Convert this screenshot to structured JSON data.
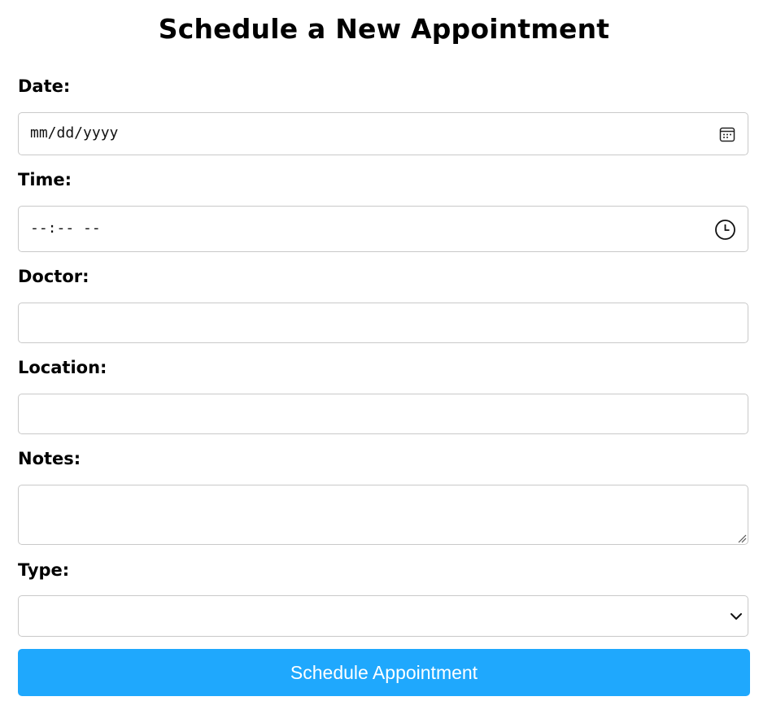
{
  "page": {
    "title": "Schedule a New Appointment"
  },
  "form": {
    "date": {
      "label": "Date:",
      "placeholder": "mm/dd/yyyy",
      "value": "",
      "icon": "calendar-icon"
    },
    "time": {
      "label": "Time:",
      "placeholder": "--:-- --",
      "value": "",
      "icon": "clock-icon"
    },
    "doctor": {
      "label": "Doctor:",
      "value": ""
    },
    "location": {
      "label": "Location:",
      "value": ""
    },
    "notes": {
      "label": "Notes:",
      "value": ""
    },
    "type": {
      "label": "Type:",
      "selected": "",
      "icon": "chevron-down-icon"
    },
    "submit_label": "Schedule Appointment"
  },
  "colors": {
    "accent": "#1fa8fd",
    "field_border": "#c9c9c9",
    "text": "#000000",
    "button_text": "#ffffff"
  }
}
